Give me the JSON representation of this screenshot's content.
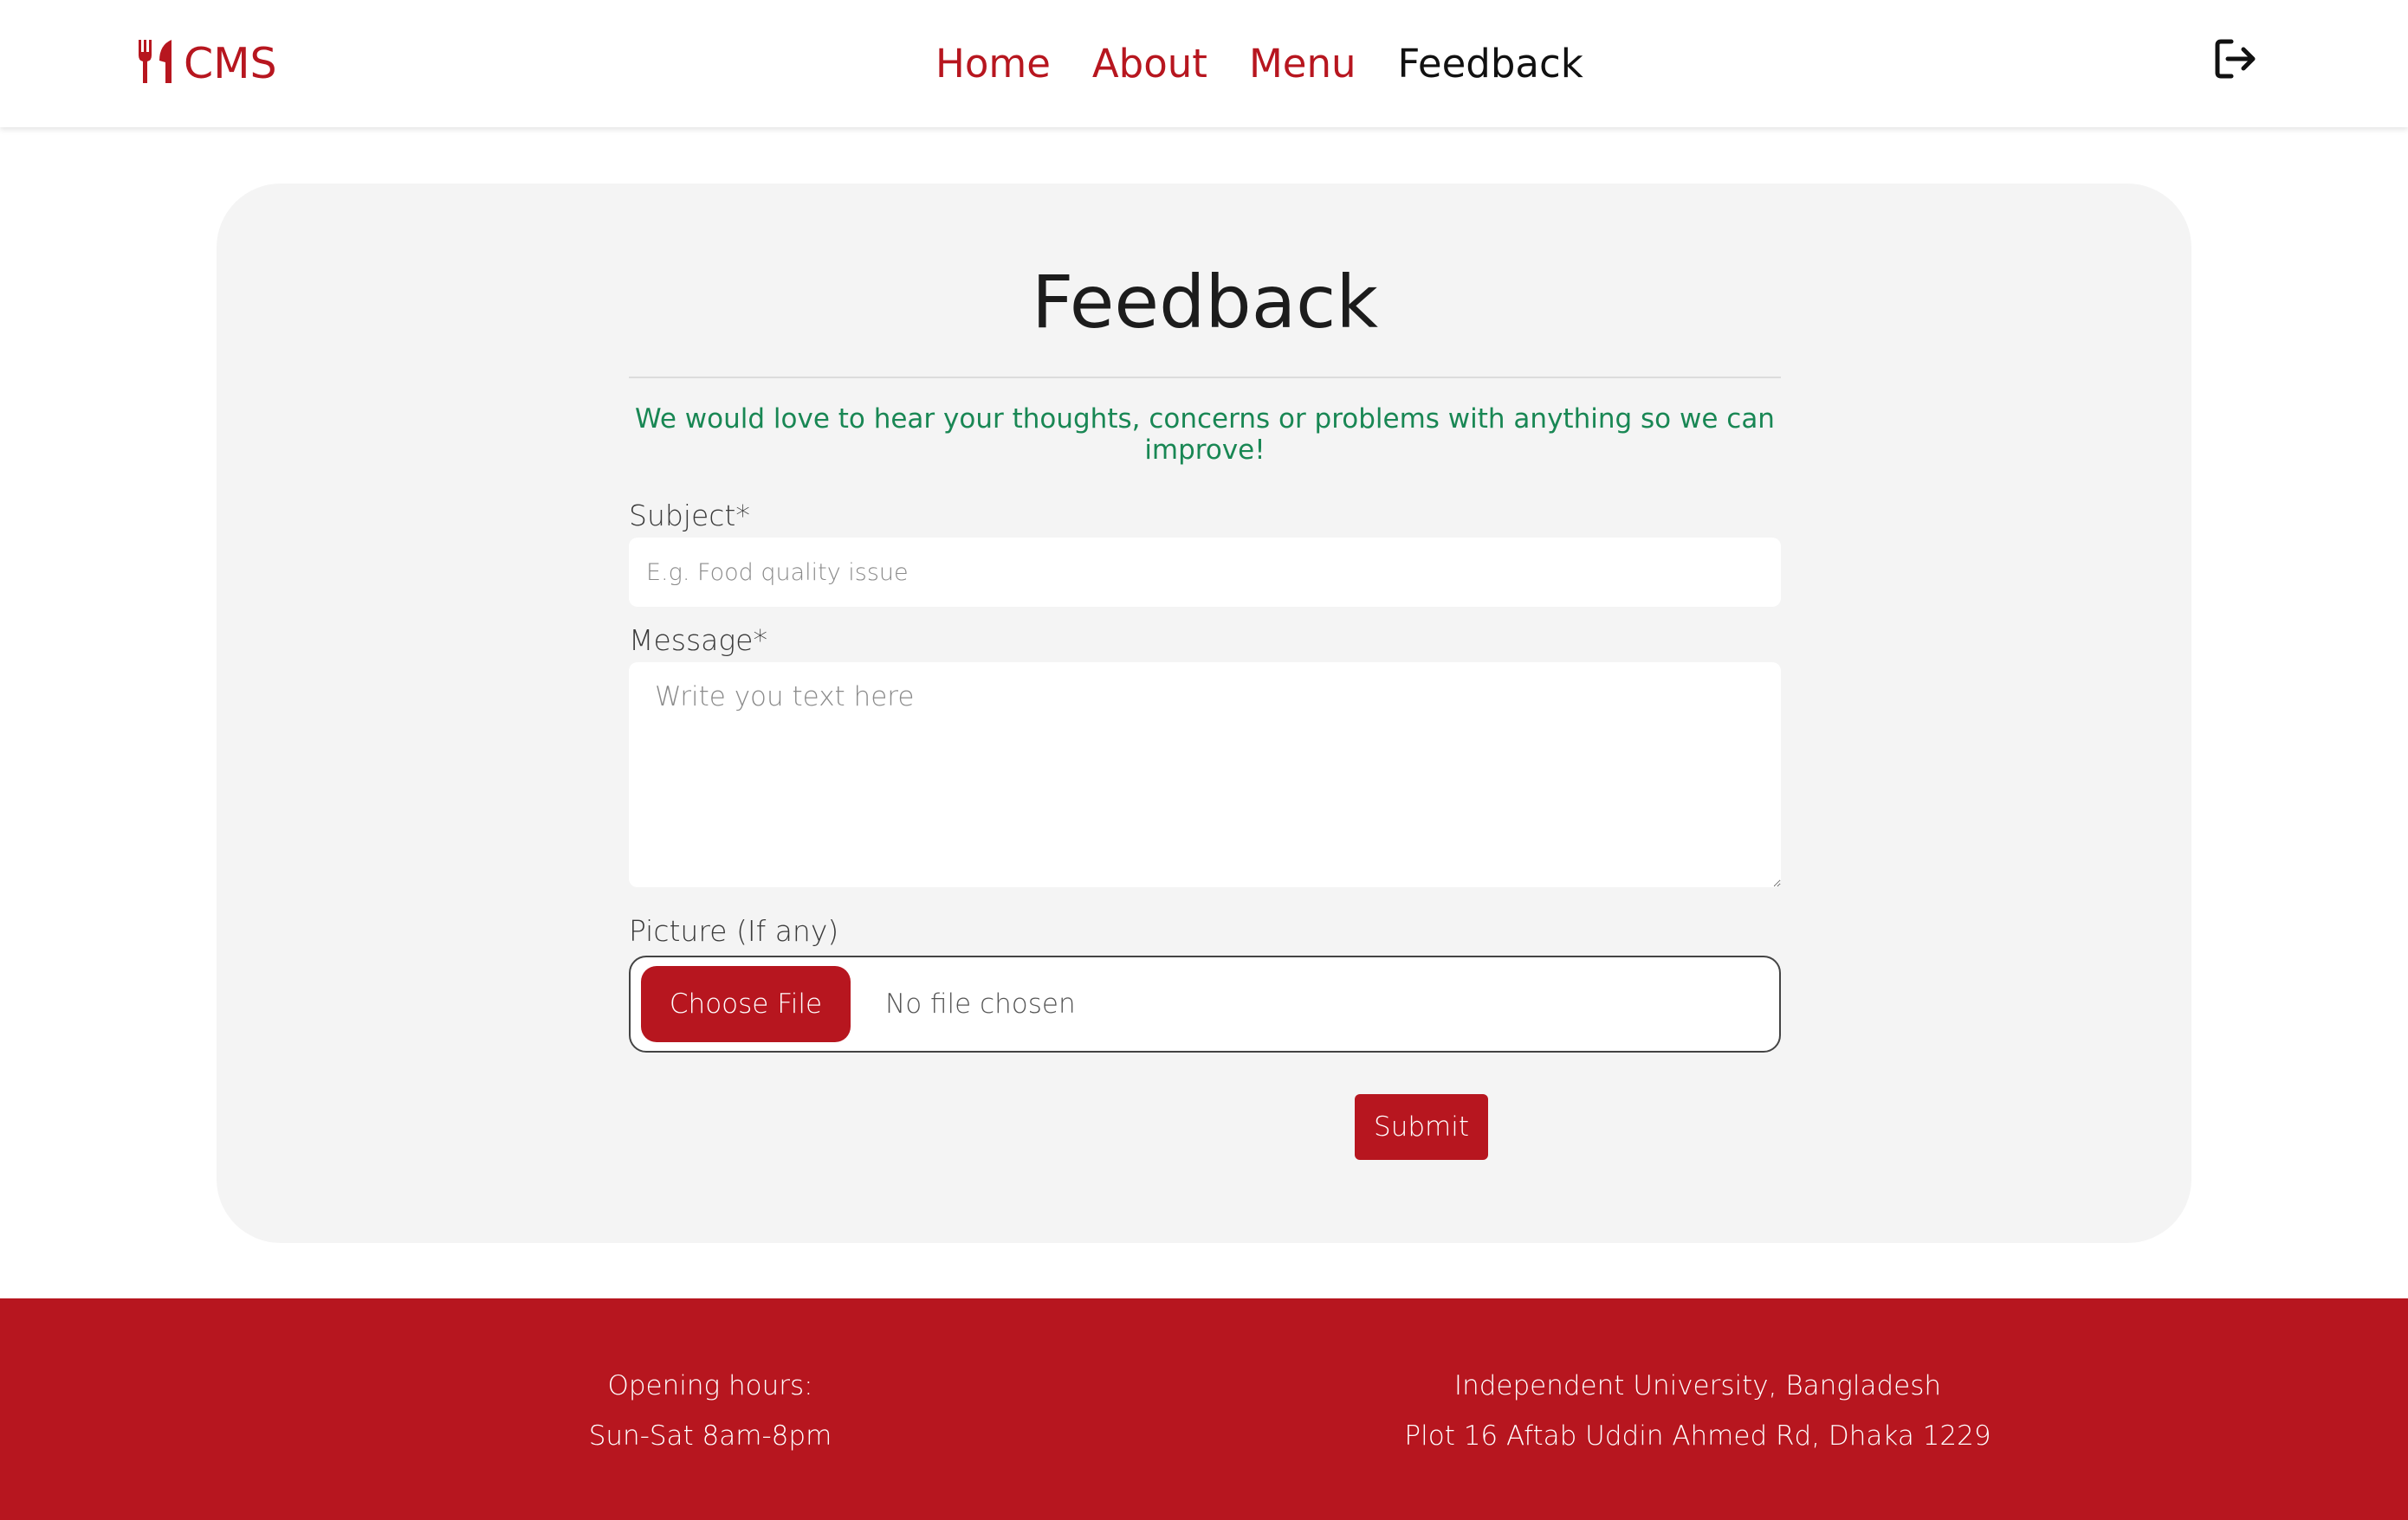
{
  "brand": {
    "name": "CMS",
    "icon": "utensils-icon"
  },
  "nav": {
    "links": [
      {
        "label": "Home",
        "active": false
      },
      {
        "label": "About",
        "active": false
      },
      {
        "label": "Menu",
        "active": false
      },
      {
        "label": "Feedback",
        "active": true
      }
    ],
    "logout_icon": "logout-icon"
  },
  "feedback": {
    "title": "Feedback",
    "intro": "We would love to hear your thoughts, concerns or problems with anything so we can improve!",
    "subject": {
      "label": "Subject*",
      "placeholder": "E.g. Food quality issue",
      "value": ""
    },
    "message": {
      "label": "Message*",
      "placeholder": "Write you text here",
      "value": ""
    },
    "picture": {
      "label": "Picture (If any)",
      "button_label": "Choose File",
      "status": "No file chosen"
    },
    "submit_label": "Submit"
  },
  "footer": {
    "hours_title": "Opening hours:",
    "hours_value": "Sun-Sat 8am-8pm",
    "address_line1": "Independent University, Bangladesh",
    "address_line2": "Plot 16 Aftab Uddin Ahmed Rd, Dhaka 1229"
  },
  "colors": {
    "brand_red": "#b7161f",
    "success_green": "#198754",
    "card_bg": "#f4f4f4"
  }
}
